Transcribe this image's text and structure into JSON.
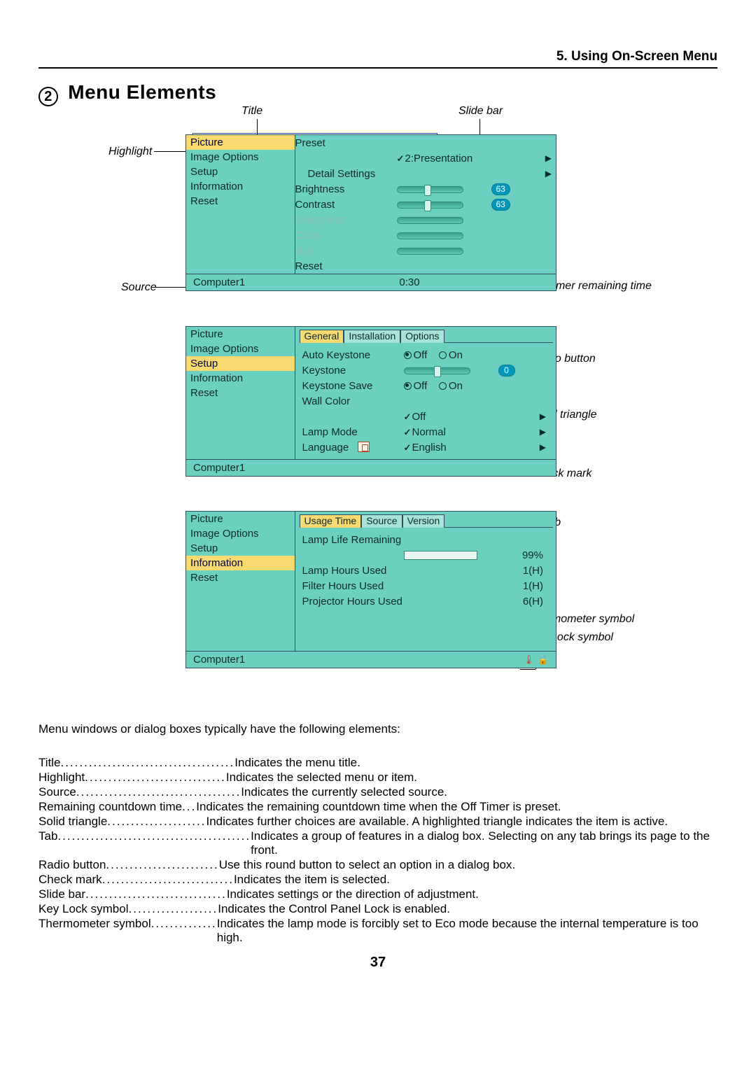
{
  "chapterHead": "5. Using On-Screen Menu",
  "sectionNumber": "2",
  "sectionTitle": "Menu Elements",
  "labels": {
    "title": "Title",
    "slidebar": "Slide bar",
    "highlight": "Highlight",
    "source": "Source",
    "offtimer": "Off Timer remaining time",
    "radiobutton": "Radio button",
    "solidtriangle": "Solid triangle",
    "checkmark": "Check mark",
    "tab": "Tab",
    "thermometer": "Thermometer symbol",
    "keylock": "Key Lock symbol"
  },
  "sidebar": {
    "items": [
      "Picture",
      "Image Options",
      "Setup",
      "Information",
      "Reset"
    ]
  },
  "menu1": {
    "preset": "Preset",
    "presetVal": "2:Presentation",
    "detail": "Detail Settings",
    "brightness": "Brightness",
    "brightnessVal": "63",
    "contrast": "Contrast",
    "contrastVal": "63",
    "sharpness": "Sharpness",
    "color": "Color",
    "hue": "Hue",
    "reset": "Reset",
    "footerSrc": "Computer1",
    "footerTime": "0:30"
  },
  "menu2": {
    "tabs": [
      "General",
      "Installation",
      "Options"
    ],
    "autoKeystone": "Auto Keystone",
    "off": "Off",
    "on": "On",
    "keystone": "Keystone",
    "keystoneVal": "0",
    "keystoneSave": "Keystone Save",
    "wallColor": "Wall Color",
    "wallColorVal": "Off",
    "lampMode": "Lamp Mode",
    "lampModeVal": "Normal",
    "language": "Language",
    "languageVal": "English",
    "footerSrc": "Computer1"
  },
  "menu3": {
    "tabs": [
      "Usage Time",
      "Source",
      "Version"
    ],
    "lampLife": "Lamp Life Remaining",
    "lampLifeVal": "99%",
    "lampHours": "Lamp Hours Used",
    "lampHoursVal": "1(H)",
    "filterHours": "Filter Hours Used",
    "filterHoursVal": "1(H)",
    "projHours": "Projector Hours Used",
    "projHoursVal": "6(H)",
    "footerSrc": "Computer1"
  },
  "intro": "Menu windows or dialog boxes typically have the following elements:",
  "defs": [
    {
      "term": "Title",
      "desc": "Indicates the menu title."
    },
    {
      "term": "Highlight",
      "desc": "Indicates the selected menu or item."
    },
    {
      "term": "Source",
      "desc": "Indicates the currently selected source."
    },
    {
      "term": "Remaining countdown time",
      "desc": "Indicates the remaining countdown time when the Off Timer is preset."
    },
    {
      "term": "Solid triangle",
      "desc": "Indicates further choices are available. A highlighted triangle indicates the item is active."
    },
    {
      "term": "Tab",
      "desc": "Indicates a group of features in a dialog box. Selecting on any tab brings its page to the front."
    },
    {
      "term": "Radio button",
      "desc": "Use this round button to select an option in a dialog box."
    },
    {
      "term": "Check mark",
      "desc": "Indicates the item is selected."
    },
    {
      "term": "Slide bar",
      "desc": "Indicates settings or the direction of adjustment."
    },
    {
      "term": "Key Lock symbol",
      "desc": "Indicates the Control Panel Lock is enabled."
    },
    {
      "term": "Thermometer symbol",
      "desc": "Indicates the lamp mode is forcibly set to Eco mode because the internal temperature is too high."
    }
  ],
  "pageNumber": "37"
}
